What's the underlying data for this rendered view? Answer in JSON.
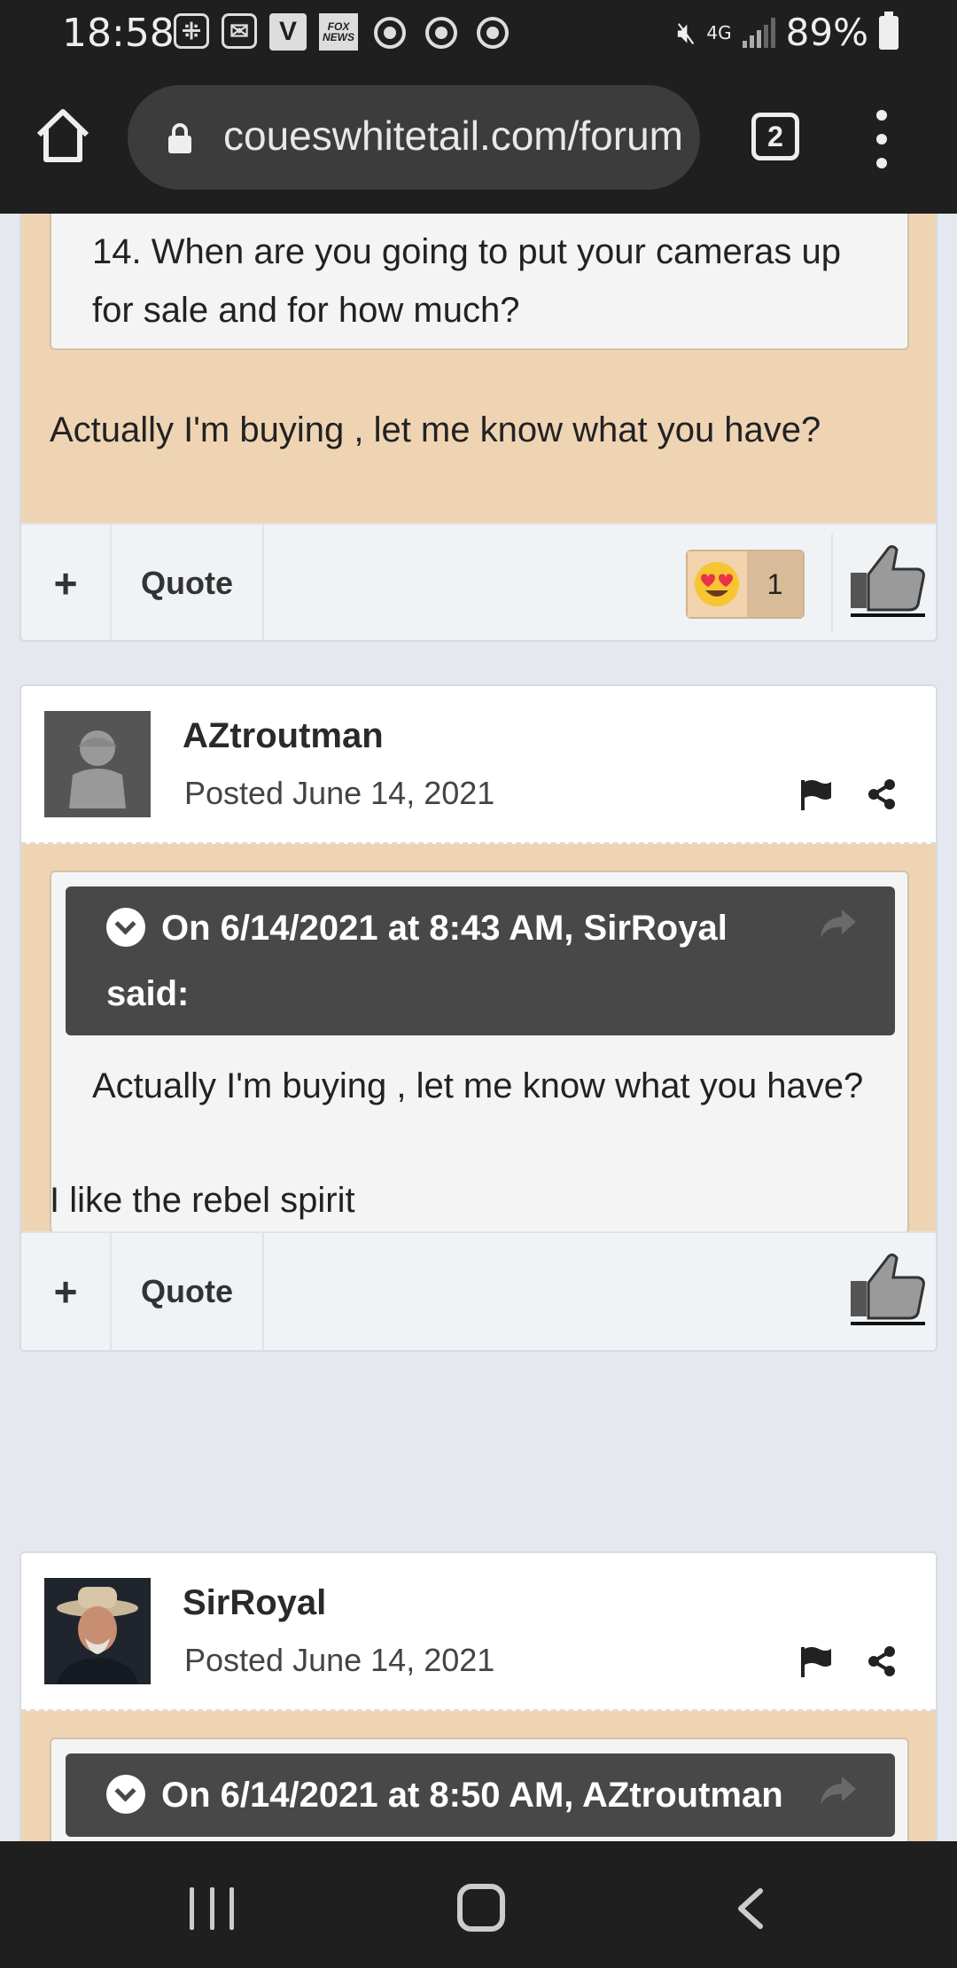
{
  "status_bar": {
    "time": "18:58",
    "notif_icons": [
      "messenger-icon",
      "gmail-icon",
      "v-app-icon",
      "fox-news-icon",
      "chrome-icon",
      "chrome-icon",
      "chrome-icon"
    ],
    "fox_label": "FOX NEWS",
    "v_label": "V",
    "network": "4G",
    "battery": "89%"
  },
  "browser": {
    "url": "coueswhitetail.com/forums",
    "tab_count": "2"
  },
  "posts": [
    {
      "quote_text": "14. When are you going to put your cameras up for sale and for how much?",
      "body": "Actually I'm buying , let me know what you have?",
      "actions": {
        "plus": "+",
        "quote": "Quote"
      },
      "reaction": {
        "icon": "heart-eyes-emoji",
        "count": "1"
      }
    },
    {
      "author": "AZtroutman",
      "posted": "Posted June 14, 2021",
      "quote_header": "On 6/14/2021 at 8:43 AM, SirRoyal said:",
      "quote_text": "Actually I'm buying , let me know what you have?",
      "body": "I like the rebel spirit",
      "actions": {
        "plus": "+",
        "quote": "Quote"
      }
    },
    {
      "author": "SirRoyal",
      "posted": "Posted June 14, 2021",
      "quote_header": "On 6/14/2021 at 8:50 AM, AZtroutman"
    }
  ],
  "colors": {
    "post_body": "#efd4b4",
    "quote_header": "#484848",
    "system_bar": "#1f1f1f"
  }
}
